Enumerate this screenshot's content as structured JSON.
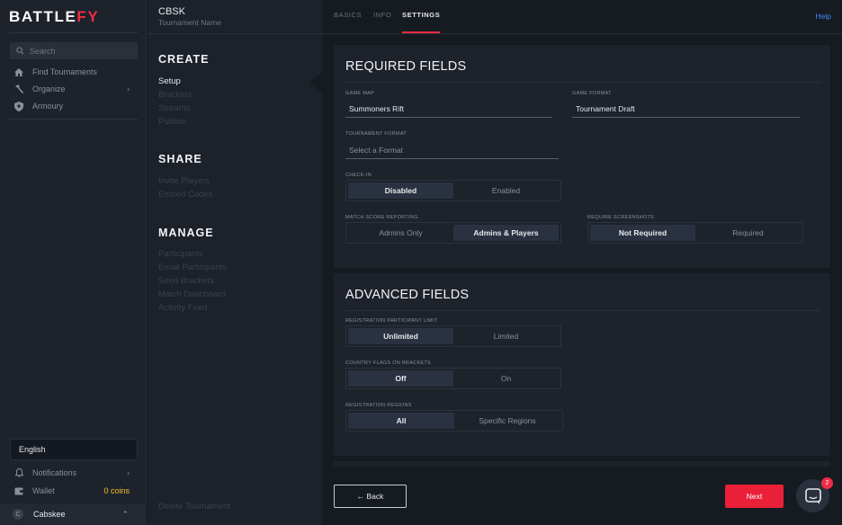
{
  "sidebar": {
    "logo_main": "BATTLE",
    "logo_accent": "FY",
    "search_placeholder": "Search",
    "nav": [
      {
        "label": "Find Tournaments",
        "icon": "home-icon"
      },
      {
        "label": "Organize",
        "icon": "hammer-icon"
      },
      {
        "label": "Armoury",
        "icon": "shield-icon"
      }
    ],
    "language": "English",
    "notifications_label": "Notifications",
    "wallet_label": "Wallet",
    "wallet_coins": "0 coins",
    "user_initial": "C",
    "username": "Cabskee"
  },
  "subnav": {
    "tournament_code": "CBSK",
    "tournament_name": "Tournament Name",
    "create": {
      "title": "CREATE",
      "items": [
        "Setup",
        "Brackets",
        "Streams",
        "Publish"
      ]
    },
    "share": {
      "title": "SHARE",
      "items": [
        "Invite Players",
        "Embed Codes"
      ]
    },
    "manage": {
      "title": "MANAGE",
      "items": [
        "Participants",
        "Email Participants",
        "Seed Brackets",
        "Match Dashboard",
        "Activity Feed"
      ]
    },
    "delete_label": "Delete Tournament"
  },
  "tabs": {
    "basics": "BASICS",
    "info": "INFO",
    "settings": "SETTINGS",
    "active": "SETTINGS",
    "help": "Help"
  },
  "required": {
    "title": "REQUIRED FIELDS",
    "game_map_label": "GAME MAP",
    "game_map_value": "Summoners Rift",
    "game_format_label": "GAME FORMAT",
    "game_format_value": "Tournament Draft",
    "tournament_format_label": "TOURNAMENT FORMAT",
    "tournament_format_placeholder": "Select a Format",
    "checkin_label": "CHECK-IN",
    "checkin_options": [
      "Disabled",
      "Enabled"
    ],
    "checkin_selected": "Disabled",
    "score_label": "MATCH SCORE REPORTING",
    "score_options": [
      "Admins Only",
      "Admins & Players"
    ],
    "score_selected": "Admins & Players",
    "screenshots_label": "REQUIRE SCREENSHOTS",
    "screenshots_options": [
      "Not Required",
      "Required"
    ],
    "screenshots_selected": "Not Required"
  },
  "advanced": {
    "title": "ADVANCED FIELDS",
    "limit_label": "REGISTRATION PARTICIPANT LIMIT",
    "limit_options": [
      "Unlimited",
      "Limited"
    ],
    "limit_selected": "Unlimited",
    "flags_label": "COUNTRY FLAGS ON BRACKETS",
    "flags_options": [
      "Off",
      "On"
    ],
    "flags_selected": "Off",
    "regions_label": "REGISTRATION REGIONS",
    "regions_options": [
      "All",
      "Specific Regions"
    ],
    "regions_selected": "All"
  },
  "footer": {
    "back_label": "← Back",
    "next_label": "Next",
    "chat_badge": "2"
  },
  "colors": {
    "accent": "#ef2d43",
    "link": "#3d8bf2",
    "coins": "#f6c12a"
  }
}
